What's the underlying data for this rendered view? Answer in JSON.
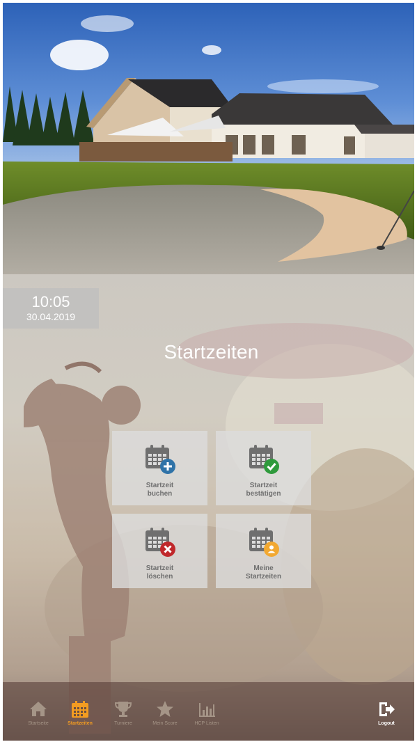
{
  "clock": {
    "time": "10:05",
    "date": "30.04.2019"
  },
  "page": {
    "title": "Startzeiten"
  },
  "tiles": [
    {
      "label": "Startzeit\nbuchen",
      "icon": "calendar-plus-icon",
      "badge_color": "#2f73a8"
    },
    {
      "label": "Startzeit\nbestätigen",
      "icon": "calendar-check-icon",
      "badge_color": "#2f9a3c"
    },
    {
      "label": "Startzeit\nlöschen",
      "icon": "calendar-x-icon",
      "badge_color": "#c0282b"
    },
    {
      "label": "Meine\nStartzeiten",
      "icon": "calendar-user-icon",
      "badge_color": "#f2a830"
    }
  ],
  "nav": {
    "items": [
      {
        "label": "Startseite",
        "icon": "home-icon"
      },
      {
        "label": "Startzeiten",
        "icon": "calendar-icon",
        "active": true
      },
      {
        "label": "Turniere",
        "icon": "trophy-icon"
      },
      {
        "label": "Mein Score",
        "icon": "star-icon"
      },
      {
        "label": "HCP Listen",
        "icon": "bar-chart-icon"
      }
    ],
    "logout": {
      "label": "Logout",
      "icon": "logout-icon"
    }
  },
  "colors": {
    "accent": "#f39c21",
    "icon_gray": "#6f6f6f",
    "tile_bg": "#dcdcdc"
  }
}
